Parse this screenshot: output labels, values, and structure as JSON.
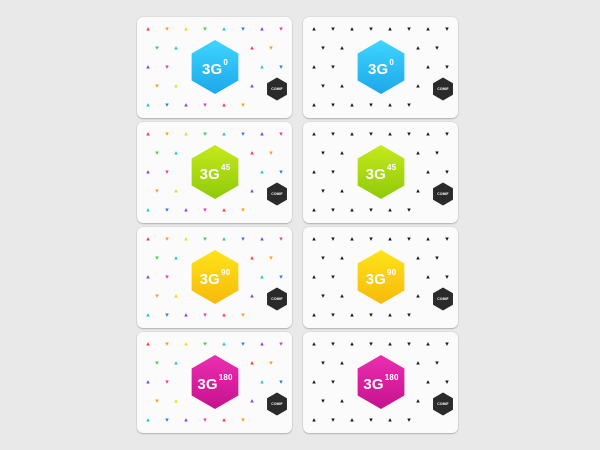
{
  "cards": [
    {
      "label_base": "3G",
      "label_sup": "0",
      "color_top": "#3ed6ff",
      "color_bottom": "#1da7ea",
      "pattern": "colored"
    },
    {
      "label_base": "3G",
      "label_sup": "0",
      "color_top": "#3ed6ff",
      "color_bottom": "#1da7ea",
      "pattern": "black"
    },
    {
      "label_base": "3G",
      "label_sup": "45",
      "color_top": "#c6ea1b",
      "color_bottom": "#8fc90b",
      "pattern": "colored"
    },
    {
      "label_base": "3G",
      "label_sup": "45",
      "color_top": "#c6ea1b",
      "color_bottom": "#8fc90b",
      "pattern": "black"
    },
    {
      "label_base": "3G",
      "label_sup": "90",
      "color_top": "#ffe419",
      "color_bottom": "#f7b90a",
      "pattern": "colored"
    },
    {
      "label_base": "3G",
      "label_sup": "90",
      "color_top": "#ffe419",
      "color_bottom": "#f7b90a",
      "pattern": "black"
    },
    {
      "label_base": "3G",
      "label_sup": "180",
      "color_top": "#eb2eb0",
      "color_bottom": "#c6128f",
      "pattern": "colored"
    },
    {
      "label_base": "3G",
      "label_sup": "180",
      "color_top": "#eb2eb0",
      "color_bottom": "#c6128f",
      "pattern": "black"
    }
  ],
  "badge": {
    "text": "COMIF"
  },
  "colors": {
    "background": "#e9e9e9",
    "card": "#fbfbfb",
    "badge": "#2a2a2a",
    "pattern_black": "#1a1a1a",
    "pattern_palette": [
      "#ff3b3b",
      "#ff9a1f",
      "#f5d90f",
      "#3ecf4a",
      "#27c2d9",
      "#2f7de8",
      "#8a3fe0",
      "#e93bb7"
    ]
  },
  "icons": {
    "hex": "hexagon-shape",
    "badge": "hexagon-badge-icon",
    "pattern": "triangle-pattern"
  }
}
